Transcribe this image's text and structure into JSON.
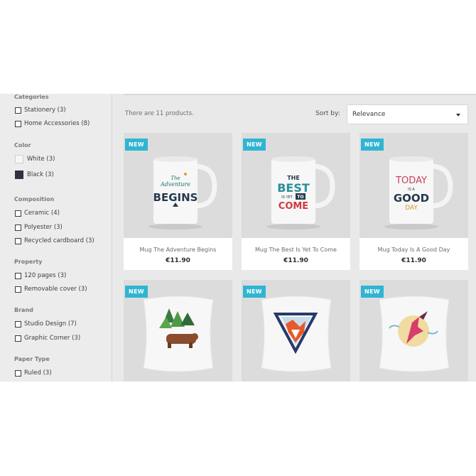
{
  "sidebar": {
    "categories": {
      "title": "Categories",
      "items": [
        {
          "label": "Stationery (3)"
        },
        {
          "label": "Home Accessories (8)"
        }
      ]
    },
    "color": {
      "title": "Color",
      "items": [
        {
          "label": "White (3)",
          "swatch": "#f6f6f6"
        },
        {
          "label": "Black (3)",
          "swatch": "#2f3340"
        }
      ]
    },
    "composition": {
      "title": "Composition",
      "items": [
        {
          "label": "Ceramic (4)"
        },
        {
          "label": "Polyester (3)"
        },
        {
          "label": "Recycled cardboard (3)"
        }
      ]
    },
    "property": {
      "title": "Property",
      "items": [
        {
          "label": "120 pages (3)"
        },
        {
          "label": "Removable cover (3)"
        }
      ]
    },
    "brand": {
      "title": "Brand",
      "items": [
        {
          "label": "Studio Design (7)"
        },
        {
          "label": "Graphic Corner (3)"
        }
      ]
    },
    "paper_type": {
      "title": "Paper Type",
      "items": [
        {
          "label": "Ruled (3)"
        }
      ]
    }
  },
  "listing": {
    "count_text": "There are 11 products.",
    "sort_label": "Sort by:",
    "sort_value": "Relevance"
  },
  "products": [
    {
      "badge": "NEW",
      "name": "Mug The Adventure Begins",
      "price": "€11.90",
      "image_art": {
        "line1": "The",
        "line2": "Adventure",
        "line3": "BEGINS"
      }
    },
    {
      "badge": "NEW",
      "name": "Mug The Best Is Yet To Come",
      "price": "€11.90",
      "image_art": {
        "line1": "THE",
        "line2": "BEST",
        "line3": "IS YET",
        "line4": "TO",
        "line5": "COME"
      }
    },
    {
      "badge": "NEW",
      "name": "Mug Today Is A Good Day",
      "price": "€11.90",
      "image_art": {
        "line1": "TODAY",
        "line2": "IS A",
        "line3": "GOOD",
        "line4": "DAY"
      }
    },
    {
      "badge": "NEW"
    },
    {
      "badge": "NEW"
    },
    {
      "badge": "NEW"
    }
  ],
  "colors": {
    "badge": "#2fb5d2",
    "sidebar_bg": "#ececec",
    "page_bg": "#e9e9e9"
  }
}
